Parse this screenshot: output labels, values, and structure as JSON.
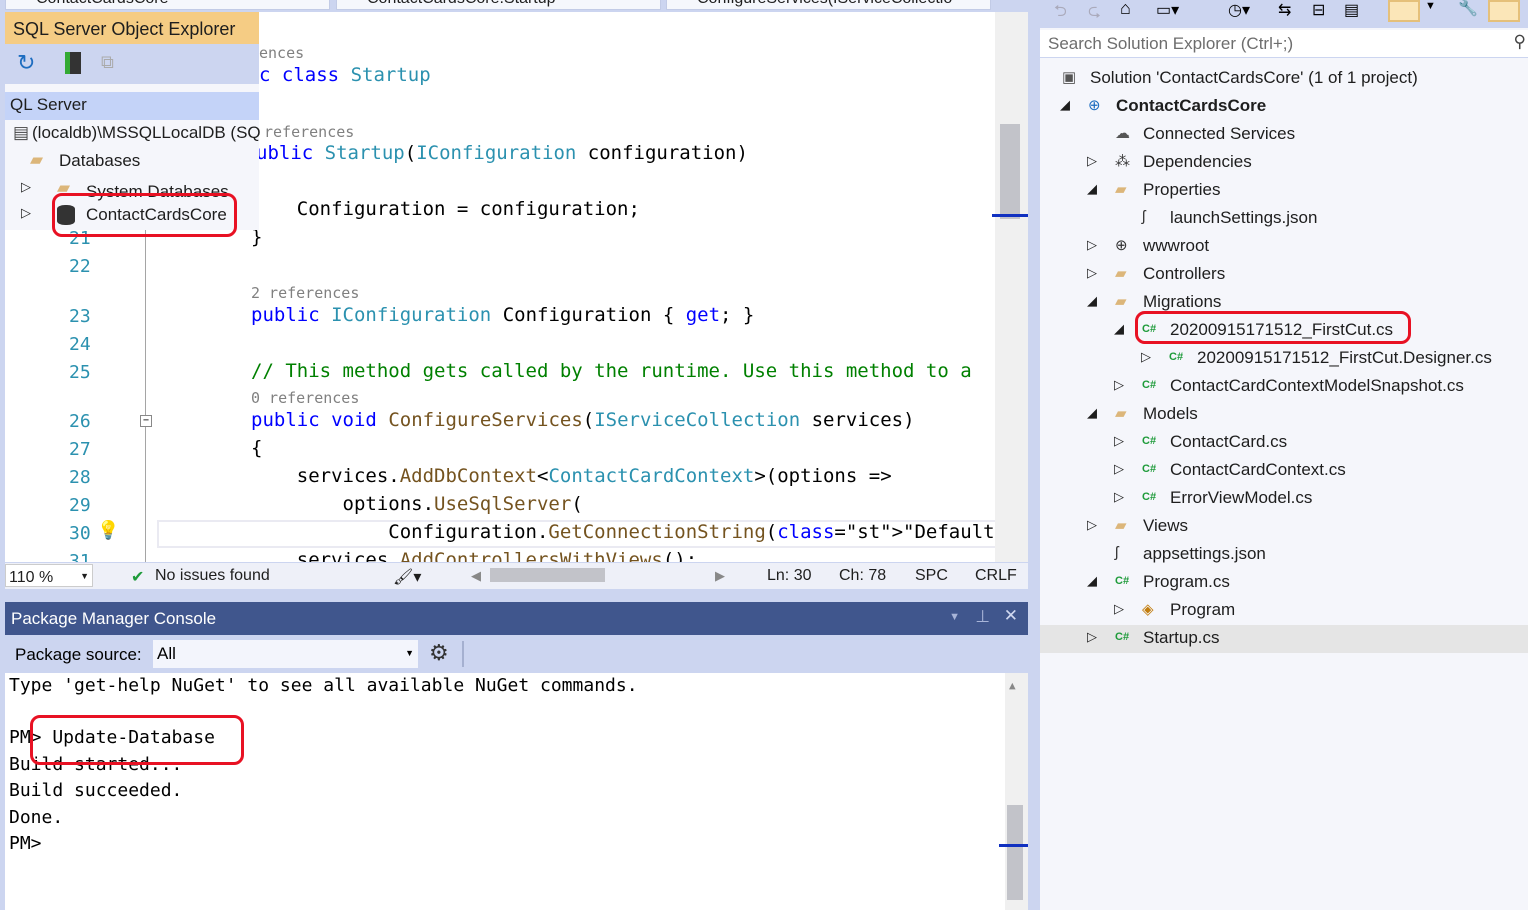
{
  "tabs": [
    "ContactCardsCore",
    "ContactCardsCore.Startup",
    "ConfigureServices(IServiceCollectio"
  ],
  "sql_explorer": {
    "title": "SQL Server Object Explorer",
    "root": "QL Server",
    "server": "(localdb)\\MSSQLLocalDB (SQ",
    "databases": "Databases",
    "system_db": "System Databases",
    "db": "ContactCardsCore"
  },
  "editor": {
    "lens1": "ences",
    "line_a": "c class Startup",
    "lens2": "references",
    "line_b": "ublic Startup(IConfiguration configuration)",
    "line_c": "    Configuration = configuration;",
    "line21": "}",
    "lens3": "2 references",
    "line23": "public IConfiguration Configuration { get; }",
    "line25": "// This method gets called by the runtime. Use this method to a",
    "lens4": "0 references",
    "line26": "public void ConfigureServices(IServiceCollection services)",
    "line27": "{",
    "line28": "    services.AddDbContext<ContactCardContext>(options =>",
    "line29": "        options.UseSqlServer(",
    "line30": "            Configuration.GetConnectionString(\"DefaultConnectio",
    "line31": "    services.AddControllersWithViews();",
    "line_numbers": [
      "21",
      "22",
      "23",
      "24",
      "25",
      "26",
      "27",
      "28",
      "29",
      "30",
      "31"
    ]
  },
  "status": {
    "zoom": "110 %",
    "issues": "No issues found",
    "ln": "Ln: 30",
    "ch": "Ch: 78",
    "spc": "SPC",
    "crlf": "CRLF"
  },
  "console": {
    "title": "Package Manager Console",
    "source_label": "Package source:",
    "source_value": "All",
    "lines": [
      "Type 'get-help NuGet' to see all available NuGet commands.",
      "",
      "PM> Update-Database",
      "Build started...",
      "Build succeeded.",
      "Done.",
      "PM>"
    ]
  },
  "solution_explorer": {
    "search_placeholder": "Search Solution Explorer (Ctrl+;)",
    "items": [
      {
        "label": "Solution 'ContactCardsCore' (1 of 1 project)",
        "level": -1,
        "arrow": "",
        "icon": "solution-icon"
      },
      {
        "label": "ContactCardsCore",
        "level": 0,
        "arrow": "expanded",
        "icon": "web-project-icon",
        "bold": true
      },
      {
        "label": "Connected Services",
        "level": 1,
        "arrow": "",
        "icon": "connected-services-icon"
      },
      {
        "label": "Dependencies",
        "level": 1,
        "arrow": "collapsed",
        "icon": "dependencies-icon"
      },
      {
        "label": "Properties",
        "level": 1,
        "arrow": "expanded",
        "icon": "folder-icon"
      },
      {
        "label": "launchSettings.json",
        "level": 2,
        "arrow": "",
        "icon": "json-icon"
      },
      {
        "label": "wwwroot",
        "level": 1,
        "arrow": "collapsed",
        "icon": "globe-icon"
      },
      {
        "label": "Controllers",
        "level": 1,
        "arrow": "collapsed",
        "icon": "folder-icon"
      },
      {
        "label": "Migrations",
        "level": 1,
        "arrow": "expanded",
        "icon": "folder-icon"
      },
      {
        "label": "20200915171512_FirstCut.cs",
        "level": 2,
        "arrow": "expanded",
        "icon": "csharp-icon"
      },
      {
        "label": "20200915171512_FirstCut.Designer.cs",
        "level": 3,
        "arrow": "collapsed",
        "icon": "csharp-icon"
      },
      {
        "label": "ContactCardContextModelSnapshot.cs",
        "level": 2,
        "arrow": "collapsed",
        "icon": "csharp-icon"
      },
      {
        "label": "Models",
        "level": 1,
        "arrow": "expanded",
        "icon": "folder-icon"
      },
      {
        "label": "ContactCard.cs",
        "level": 2,
        "arrow": "collapsed",
        "icon": "csharp-icon"
      },
      {
        "label": "ContactCardContext.cs",
        "level": 2,
        "arrow": "collapsed",
        "icon": "csharp-icon"
      },
      {
        "label": "ErrorViewModel.cs",
        "level": 2,
        "arrow": "collapsed",
        "icon": "csharp-icon"
      },
      {
        "label": "Views",
        "level": 1,
        "arrow": "collapsed",
        "icon": "folder-icon"
      },
      {
        "label": "appsettings.json",
        "level": 1,
        "arrow": "",
        "icon": "json-icon"
      },
      {
        "label": "Program.cs",
        "level": 1,
        "arrow": "expanded",
        "icon": "csharp-icon"
      },
      {
        "label": "Program",
        "level": 2,
        "arrow": "collapsed",
        "icon": "class-icon"
      },
      {
        "label": "Startup.cs",
        "level": 1,
        "arrow": "collapsed",
        "icon": "csharp-icon",
        "selected": true
      }
    ]
  },
  "colors": {
    "highlight": "#e81123",
    "accent": "#40568d",
    "chrome": "#ccd5f0"
  }
}
